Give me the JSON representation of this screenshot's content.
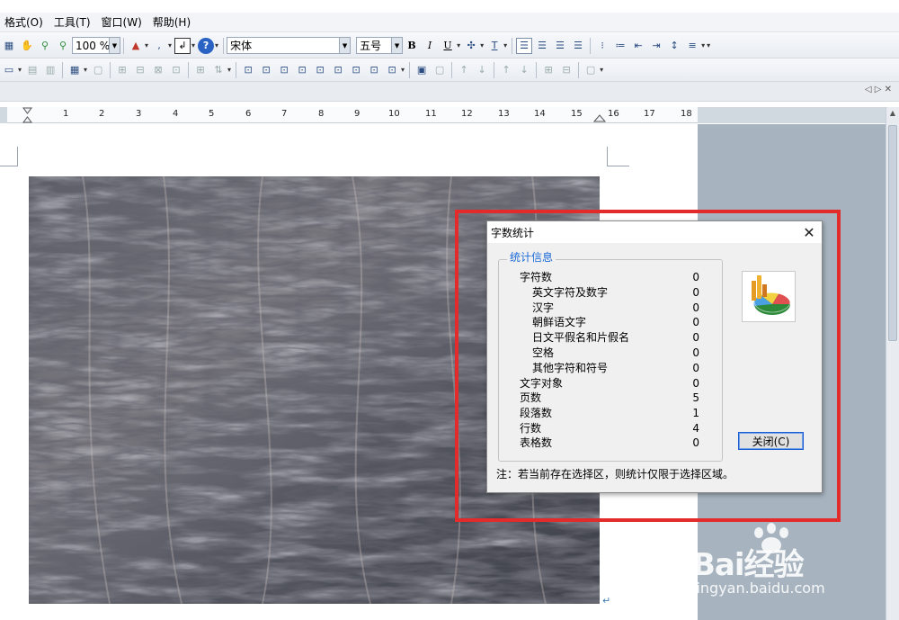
{
  "menu": {
    "items": [
      "格式(O)",
      "工具(T)",
      "窗口(W)",
      "帮助(H)"
    ]
  },
  "toolbar": {
    "zoom": "100 %",
    "font_name": "宋体",
    "font_size": "五号",
    "bold": "B",
    "italic": "I",
    "underline": "U"
  },
  "ruler": {
    "numbers": [
      "1",
      "2",
      "3",
      "4",
      "5",
      "6",
      "7",
      "8",
      "9",
      "10",
      "11",
      "12",
      "13",
      "14",
      "15",
      "16",
      "17",
      "18"
    ]
  },
  "dialog": {
    "title": "字数统计",
    "close_glyph": "✕",
    "group_title": "统计信息",
    "stats": [
      {
        "label": "字符数",
        "value": "0",
        "indent": false
      },
      {
        "label": "英文字符及数字",
        "value": "0",
        "indent": true
      },
      {
        "label": "汉字",
        "value": "0",
        "indent": true
      },
      {
        "label": "朝鲜语文字",
        "value": "0",
        "indent": true
      },
      {
        "label": "日文平假名和片假名",
        "value": "0",
        "indent": true
      },
      {
        "label": "空格",
        "value": "0",
        "indent": true
      },
      {
        "label": "其他字符和符号",
        "value": "0",
        "indent": true
      },
      {
        "label": "文字对象",
        "value": "0",
        "indent": false
      },
      {
        "label": "页数",
        "value": "5",
        "indent": false
      },
      {
        "label": "段落数",
        "value": "1",
        "indent": false
      },
      {
        "label": "行数",
        "value": "4",
        "indent": false
      },
      {
        "label": "表格数",
        "value": "0",
        "indent": false
      }
    ],
    "close_button": "关闭(C)",
    "note": "注：若当前存在选择区，则统计仅限于选择区域。"
  },
  "watermark": {
    "brand": "Bai经验",
    "url": "jingyan.baidu.com"
  },
  "colors": {
    "highlight": "#e32b2b",
    "group_title": "#1a6ad8"
  }
}
